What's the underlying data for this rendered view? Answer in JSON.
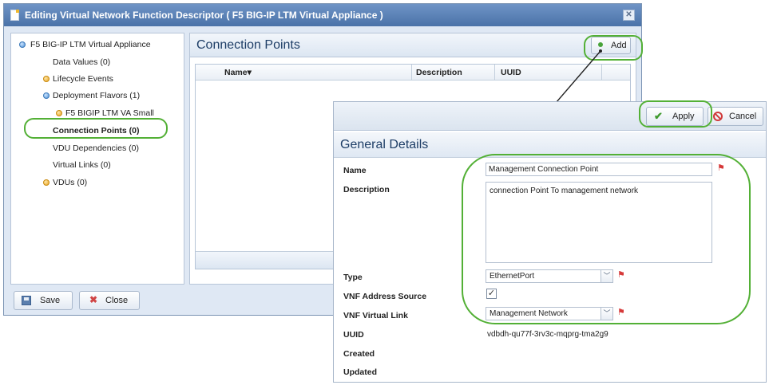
{
  "window": {
    "title": "Editing Virtual Network Function Descriptor ( F5 BIG-IP LTM Virtual Appliance )",
    "close_glyph": "✕"
  },
  "tree": {
    "items": [
      {
        "label": "F5 BIG-IP LTM Virtual Appliance",
        "bullet": "blue"
      },
      {
        "label": "Data Values (0)",
        "bullet": "none"
      },
      {
        "label": "Lifecycle Events",
        "bullet": "orange"
      },
      {
        "label": "Deployment Flavors (1)",
        "bullet": "blue"
      },
      {
        "label": "F5 BIGIP LTM VA Small",
        "bullet": "orange"
      },
      {
        "label": "Connection Points (0)",
        "bullet": "none",
        "selected": true
      },
      {
        "label": "VDU Dependencies (0)",
        "bullet": "none"
      },
      {
        "label": "Virtual Links (0)",
        "bullet": "none"
      },
      {
        "label": "VDUs (0)",
        "bullet": "orange"
      }
    ]
  },
  "connection_points": {
    "title": "Connection Points",
    "add_label": "Add",
    "columns": [
      "Name",
      "Description",
      "UUID"
    ],
    "sort_glyph": "▾"
  },
  "footer": {
    "save_label": "Save",
    "close_label": "Close"
  },
  "dialog": {
    "apply_label": "Apply",
    "cancel_label": "Cancel",
    "section_title": "General Details",
    "fields": {
      "name_label": "Name",
      "name_value": "Management Connection Point",
      "description_label": "Description",
      "description_value": "connection Point To management network",
      "type_label": "Type",
      "type_value": "EthernetPort",
      "vnf_address_source_label": "VNF Address Source",
      "vnf_address_source_checked": true,
      "vnf_virtual_link_label": "VNF Virtual Link",
      "vnf_virtual_link_value": "Management Network",
      "uuid_label": "UUID",
      "uuid_value": "vdbdh-qu77f-3rv3c-mqprg-tma2g9",
      "created_label": "Created",
      "updated_label": "Updated"
    }
  },
  "colors": {
    "annotation": "#53b036",
    "titlebar": "#4a72a8",
    "section_title": "#1d3d66",
    "required": "#d63a3a"
  }
}
